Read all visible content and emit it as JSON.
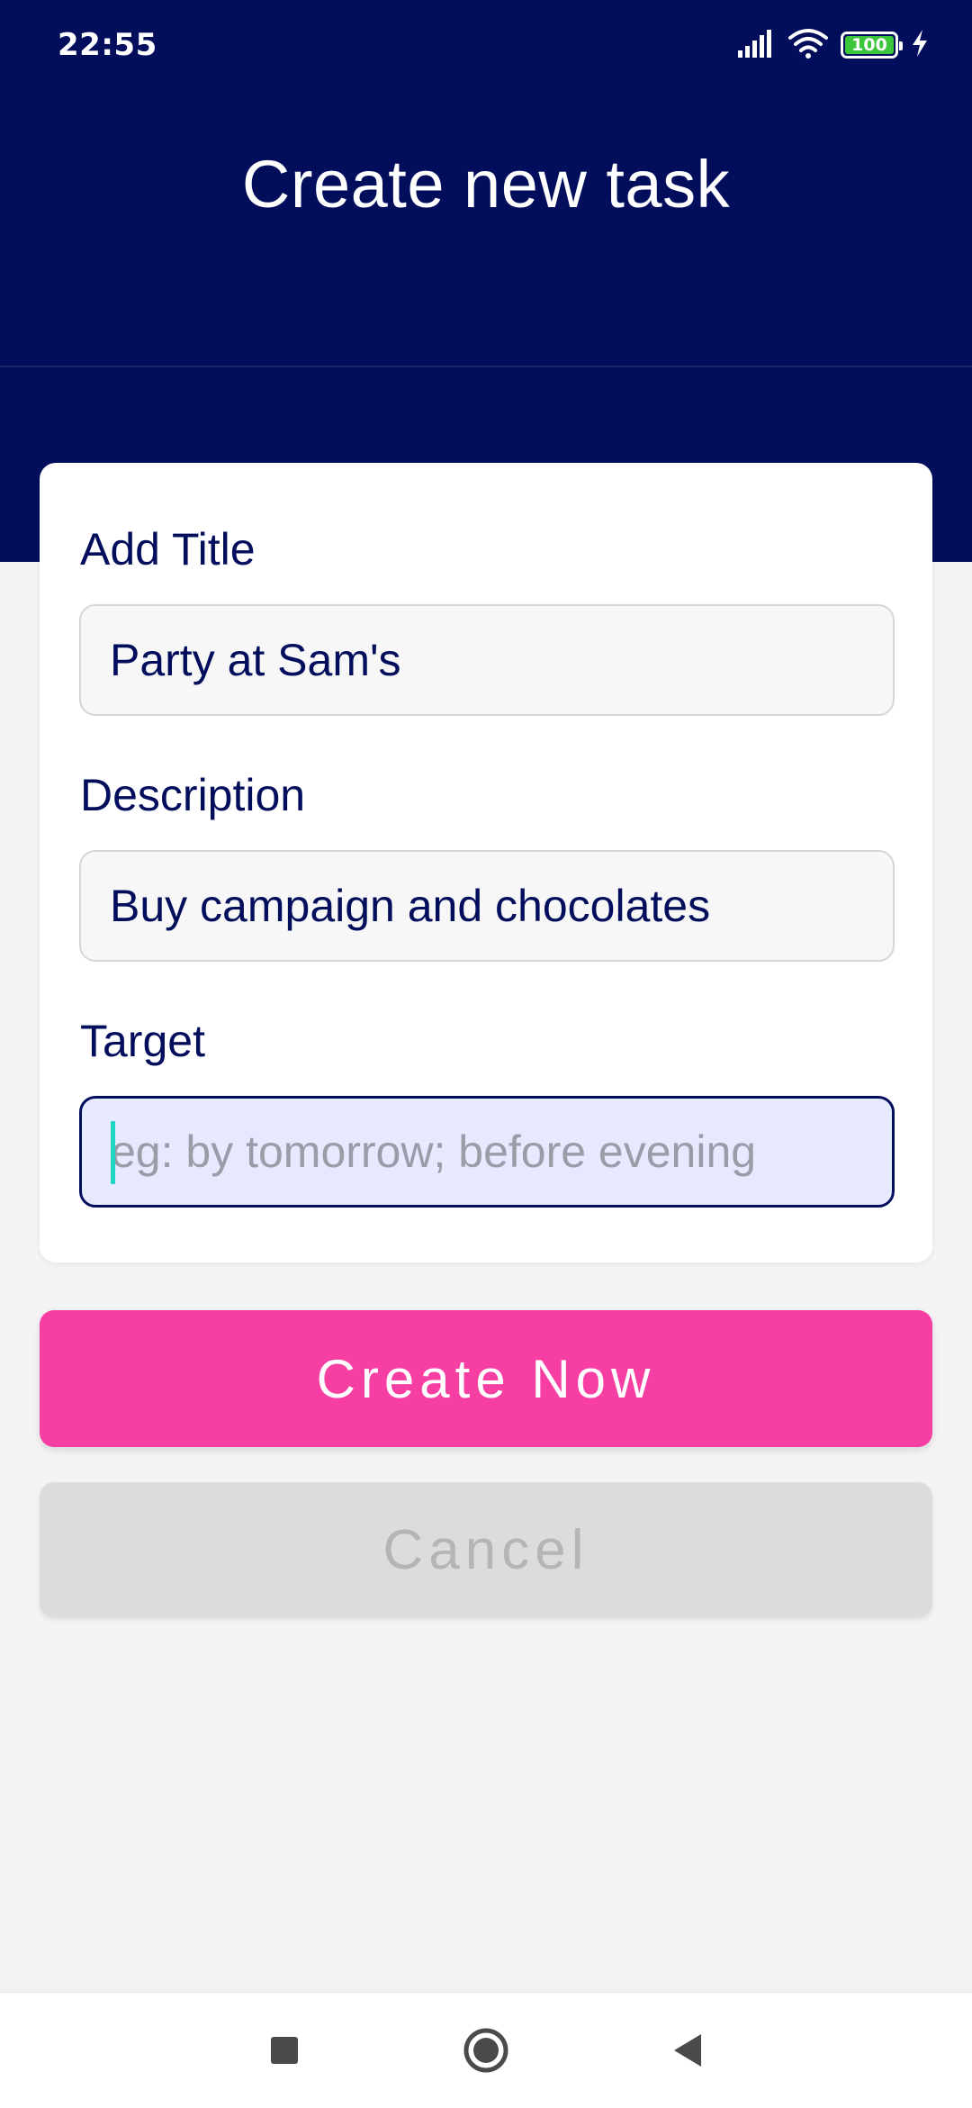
{
  "status_bar": {
    "time": "22:55",
    "battery_level": "100",
    "icons": [
      "signal-icon",
      "wifi-icon",
      "battery-icon",
      "charging-icon"
    ]
  },
  "header": {
    "title": "Create new task"
  },
  "form": {
    "title_label": "Add Title",
    "title_value": "Party at Sam's",
    "description_label": "Description",
    "description_value": "Buy campaign and chocolates",
    "target_label": "Target",
    "target_placeholder": "eg: by tomorrow; before evening",
    "target_value": ""
  },
  "actions": {
    "create_label": "Create Now",
    "cancel_label": "Cancel"
  },
  "nav": {
    "icons": [
      "recents-icon",
      "home-icon",
      "back-icon"
    ]
  },
  "colors": {
    "header_bg": "#020d5c",
    "accent": "#f73fa3",
    "page_bg": "#f3f3f3",
    "text_primary": "#020d5c",
    "caret": "#1fd6c1",
    "focused_input_bg": "#e7e9ff"
  }
}
